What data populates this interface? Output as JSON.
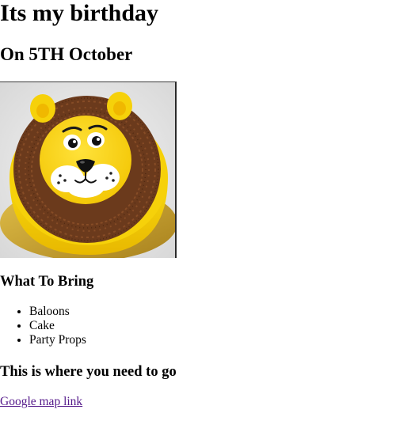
{
  "page": {
    "title": "Its my birthday",
    "subtitle": "On 5TH October"
  },
  "cake_image": {
    "icon": "lion-cake-image"
  },
  "bring_section": {
    "heading": "What To Bring",
    "items": [
      "Baloons",
      "Cake",
      "Party Props"
    ]
  },
  "location_section": {
    "heading": "This is where you need to go",
    "link_text": "Google map link"
  },
  "colors": {
    "visited_link": "#551a8b",
    "cake_yellow": "#f6d10a",
    "mane_brown": "#6b3a1c",
    "board_gold": "#c9a22a"
  }
}
